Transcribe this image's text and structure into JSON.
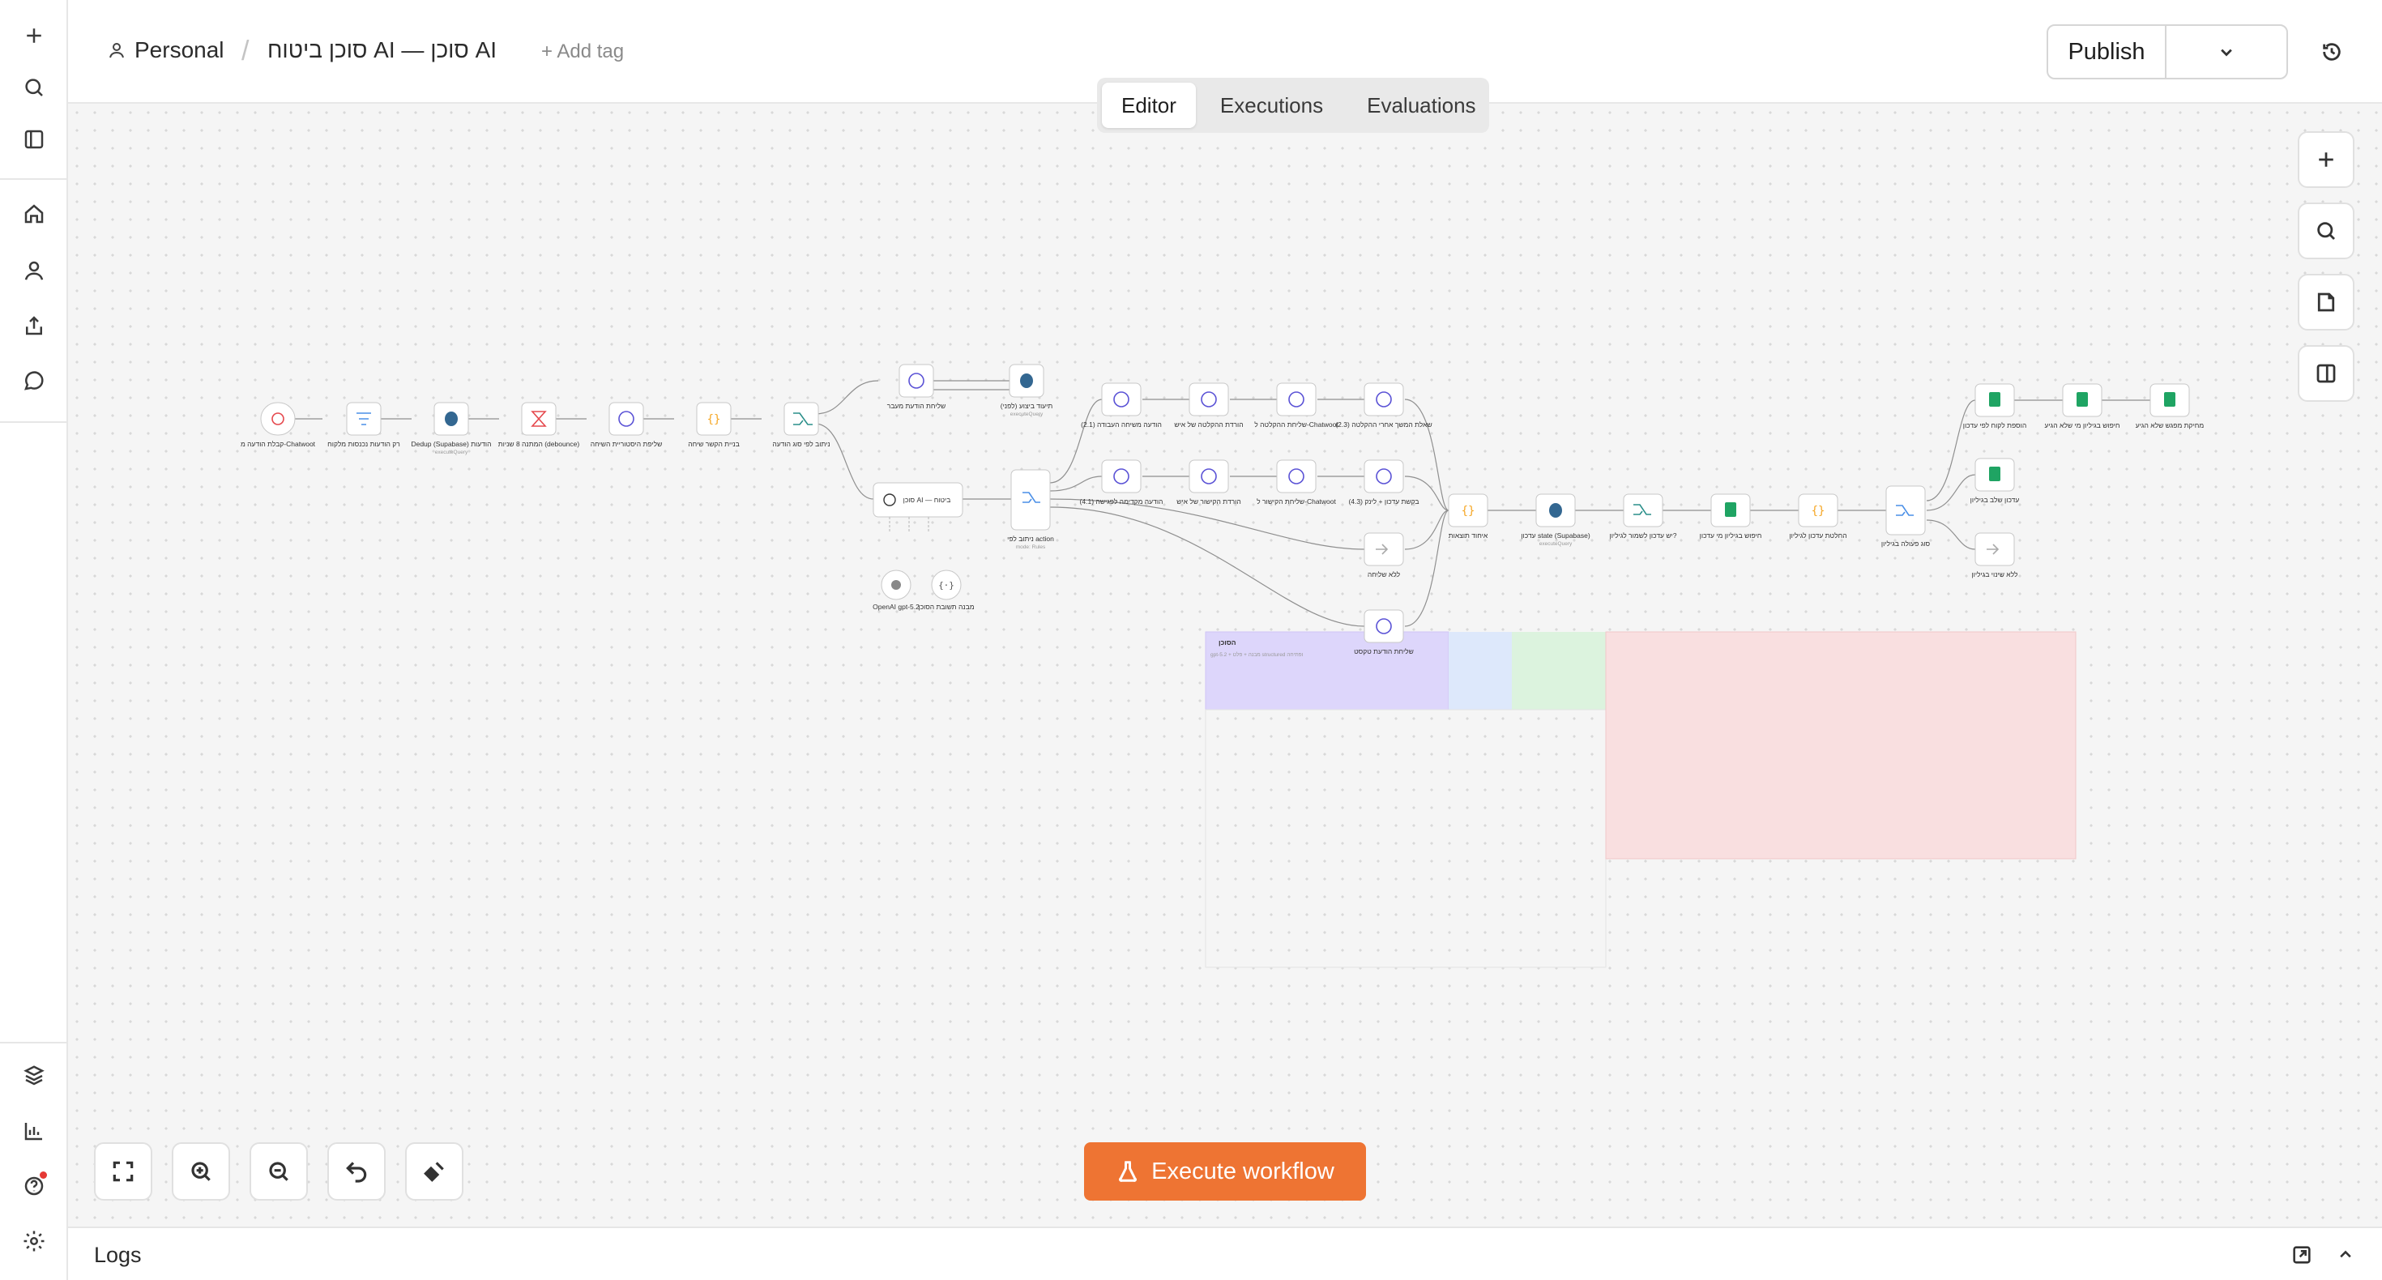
{
  "header": {
    "project_label": "Personal",
    "separator": "/",
    "workflow_title": "סוכן ביטוח AI — סוכן AI",
    "add_tag_label": "+ Add tag",
    "publish_label": "Publish"
  },
  "tabs": [
    {
      "label": "Editor",
      "active": true
    },
    {
      "label": "Executions",
      "active": false
    },
    {
      "label": "Evaluations",
      "active": false
    }
  ],
  "canvas": {
    "execute_label": "Execute workflow",
    "accent_color": "#ee7433",
    "nodes": [
      {
        "label": "קבלת הודעה מ-Chatwoot",
        "icon": "webhook-icon"
      },
      {
        "label": "רק הודעות נכנסות מלקוח",
        "icon": "filter-icon"
      },
      {
        "label": "Dedup (Supabase) הודעות",
        "sub": "executeQuery",
        "icon": "postgres-icon"
      },
      {
        "label": "המתנה 8 שניות (debounce)",
        "icon": "wait-icon"
      },
      {
        "label": "שליפת היסטוריית השיחה",
        "icon": "http-icon"
      },
      {
        "label": "בניית הקשר שיחה",
        "icon": "code-icon"
      },
      {
        "label": "ניתוב לפי סוג הודעה",
        "icon": "switch-icon"
      },
      {
        "label": "שליחת הודעת מעבר",
        "icon": "http-icon"
      },
      {
        "label": "תיעוד ביצוע (לפני)",
        "sub": "executeQuery",
        "icon": "postgres-icon"
      },
      {
        "label": "סוכן AI — ביטוח",
        "icon": "agent-icon"
      },
      {
        "label": "OpenAI gpt-5.2",
        "icon": "openai-icon"
      },
      {
        "label": "מבנה תשובת הסוכן",
        "icon": "parser-icon"
      },
      {
        "label": "ניתוב לפי action",
        "sub": "mode: Rules",
        "icon": "switch-icon"
      },
      {
        "label": "הודעה משיחה העבודה (2.1)",
        "icon": "http-icon"
      },
      {
        "label": "הורדת ההקלטה של איש",
        "icon": "http-icon"
      },
      {
        "label": "שליחת ההקלטה ל-Chatwoot",
        "icon": "http-icon"
      },
      {
        "label": "שאלת המשך אחרי ההקלטה (2.3)",
        "icon": "http-icon"
      },
      {
        "label": "הודעה מקדימה לפגישה (4.1)",
        "icon": "http-icon"
      },
      {
        "label": "הורדת הקישור של איש",
        "icon": "http-icon"
      },
      {
        "label": "שליחת הקישור ל-Chatwoot",
        "icon": "http-icon"
      },
      {
        "label": "בקשת עדכון + לינק (4.3)",
        "icon": "http-icon"
      },
      {
        "label": "ללא שליחה",
        "icon": "noop-icon"
      },
      {
        "label": "שליחת הודעת טקסט",
        "icon": "http-icon"
      },
      {
        "label": "איחוד תוצאות",
        "icon": "code-icon"
      },
      {
        "label": "עדכון state (Supabase)",
        "sub": "executeQuery",
        "icon": "postgres-icon"
      },
      {
        "label": "יש עדכון לשמור לגיליון?",
        "icon": "switch-icon"
      },
      {
        "label": "חיפוש בגיליון מי עדכון",
        "icon": "sheets-icon"
      },
      {
        "label": "החלטת עדכון לגיליון",
        "icon": "code-icon"
      },
      {
        "label": "סוג פעולה בגיליון",
        "icon": "switch-icon"
      },
      {
        "label": "הוספת לקוח לפי עדכון",
        "icon": "sheets-icon"
      },
      {
        "label": "חיפוש בגיליון מי שלא הגיע",
        "icon": "sheets-icon"
      },
      {
        "label": "מחיקת מפגש שלא הגיע",
        "icon": "sheets-icon"
      },
      {
        "label": "עדכון שלב בגיליון",
        "icon": "sheets-icon"
      },
      {
        "label": "ללא שינוי בגיליון",
        "icon": "noop-icon"
      }
    ],
    "sticky_note": {
      "title": "הסוכן",
      "body": "gpt-5.2 + מבנה + פלט structured ופתיחה"
    }
  },
  "logs": {
    "label": "Logs"
  }
}
